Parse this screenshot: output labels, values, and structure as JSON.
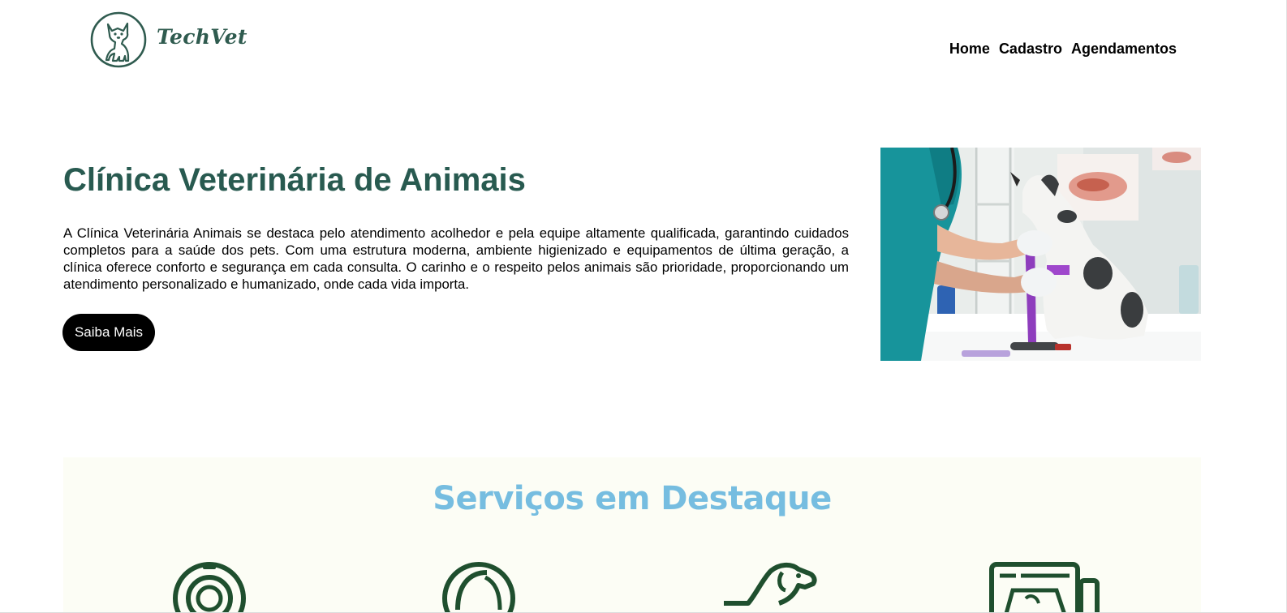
{
  "brand": {
    "name": "TechVet",
    "logo_icon": "dog-silhouette-icon",
    "color": "#2f5b4f"
  },
  "nav": {
    "items": [
      "Home",
      "Cadastro",
      "Agendamentos"
    ]
  },
  "hero": {
    "title": "Clínica Veterinária de Animais",
    "paragraph": "A Clínica Veterinária Animais se destaca pelo atendimento acolhedor e pela equipe altamente qualificada, garantindo cuidados completos para a saúde dos pets. Com uma estrutura moderna, ambiente higienizado e equipamentos de última geração, a clínica oferece conforto e segurança em cada consulta. O carinho e o respeito pelos animais são prioridade, proporcionando um atendimento personalizado e humanizado, onde cada vida importa.",
    "button_label": "Saiba Mais",
    "title_color": "#285a50",
    "photo": "vet-examining-dog-photo"
  },
  "services": {
    "title": "Serviços em Destaque",
    "title_color": "#76bde0",
    "background": "#fcfdf5",
    "icons": [
      "stethoscope-icon",
      "pet-bowl-icon",
      "dog-icon",
      "ultrasound-monitor-icon"
    ]
  }
}
